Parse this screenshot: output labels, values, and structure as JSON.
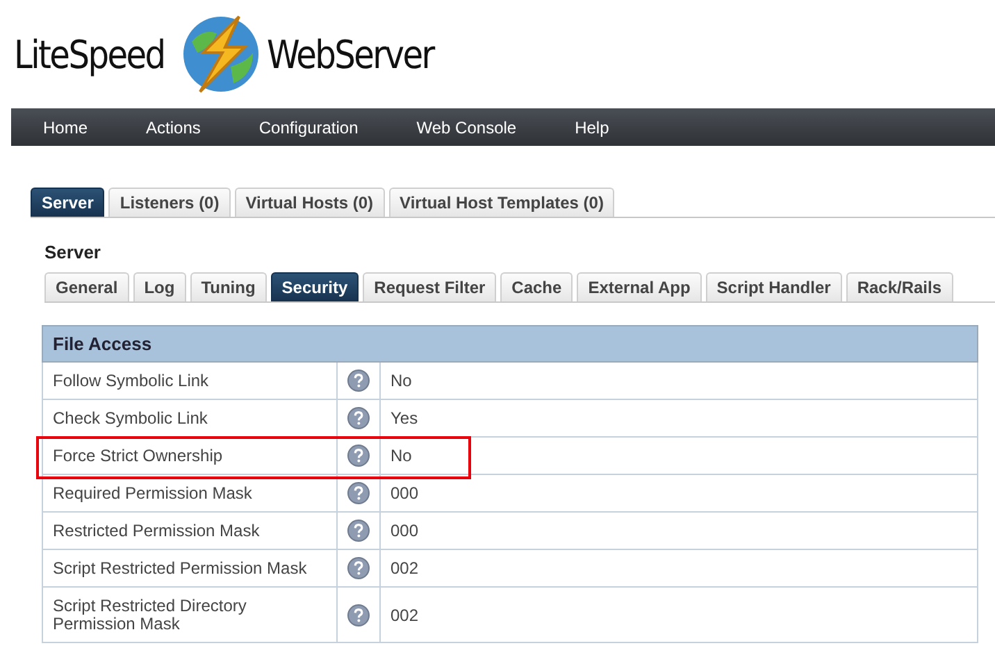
{
  "logo": {
    "left": "LiteSpeed",
    "right": "WebServer"
  },
  "nav": [
    "Home",
    "Actions",
    "Configuration",
    "Web Console",
    "Help"
  ],
  "tabs": [
    {
      "label": "Server",
      "selected": true
    },
    {
      "label": "Listeners (0)",
      "selected": false
    },
    {
      "label": "Virtual Hosts (0)",
      "selected": false
    },
    {
      "label": "Virtual Host Templates (0)",
      "selected": false
    }
  ],
  "section_title": "Server",
  "subtabs": [
    {
      "label": "General",
      "selected": false
    },
    {
      "label": "Log",
      "selected": false
    },
    {
      "label": "Tuning",
      "selected": false
    },
    {
      "label": "Security",
      "selected": true
    },
    {
      "label": "Request Filter",
      "selected": false
    },
    {
      "label": "Cache",
      "selected": false
    },
    {
      "label": "External App",
      "selected": false
    },
    {
      "label": "Script Handler",
      "selected": false
    },
    {
      "label": "Rack/Rails",
      "selected": false
    }
  ],
  "table": {
    "title": "File Access",
    "rows": [
      {
        "label": "Follow Symbolic Link",
        "value": "No",
        "highlighted": false
      },
      {
        "label": "Check Symbolic Link",
        "value": "Yes",
        "highlighted": false
      },
      {
        "label": "Force Strict Ownership",
        "value": "No",
        "highlighted": true
      },
      {
        "label": "Required Permission Mask",
        "value": "000",
        "highlighted": false
      },
      {
        "label": "Restricted Permission Mask",
        "value": "000",
        "highlighted": false
      },
      {
        "label": "Script Restricted Permission Mask",
        "value": "002",
        "highlighted": false
      },
      {
        "label": "Script Restricted Directory Permission Mask",
        "value": "002",
        "highlighted": false
      }
    ]
  }
}
